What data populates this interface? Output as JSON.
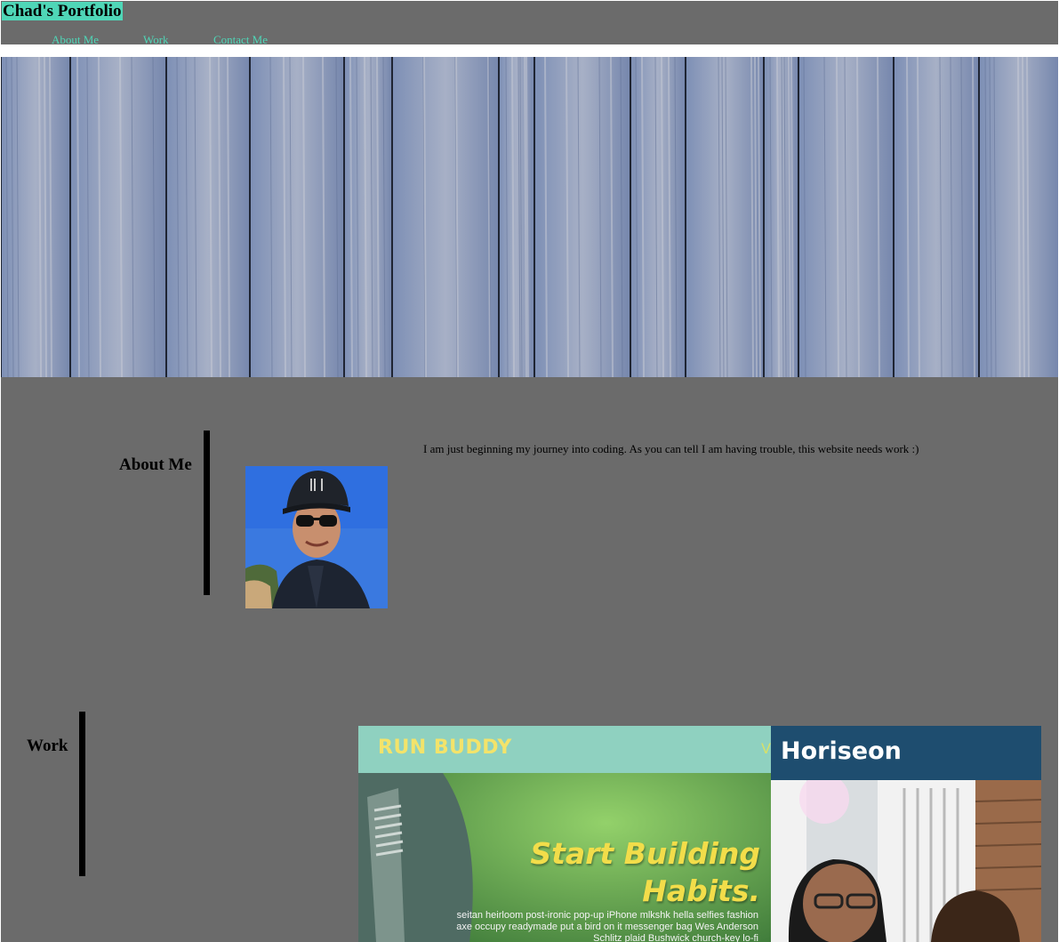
{
  "header": {
    "brand": "Chad's Portfolio",
    "nav": [
      "About Me",
      "Work",
      "Contact Me"
    ]
  },
  "about": {
    "title": "About Me",
    "text": "I am just beginning my journey into coding. As you can tell I am having trouble, this website needs work :)"
  },
  "work": {
    "title": "Work",
    "projects": [
      {
        "logo": "RUN BUDDY",
        "edge_letter": "V",
        "headline_1": "Start Building",
        "headline_2": "Habits.",
        "body": "seitan heirloom post-ironic pop-up iPhone mlkshk hella selfies fashion axe occupy readymade put a bird on it messenger bag Wes Anderson Schlitz plaid Bushwick church-key lo-fi"
      },
      {
        "logo": "Horiseon"
      }
    ]
  },
  "colors": {
    "accent": "#4fd6b7",
    "page_background": "#6b6b6b"
  }
}
